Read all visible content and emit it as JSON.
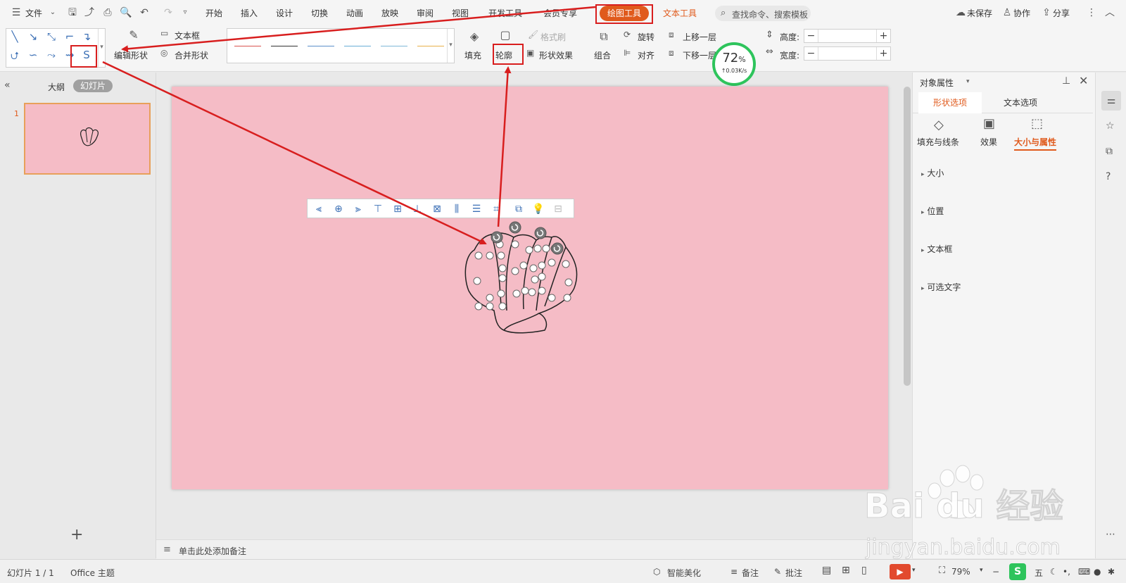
{
  "menubar": {
    "file": "文件",
    "tabs": [
      "开始",
      "插入",
      "设计",
      "切换",
      "动画",
      "放映",
      "审阅",
      "视图",
      "开发工具",
      "会员专享"
    ],
    "active_tab": "绘图工具",
    "text_tools_tab": "文本工具",
    "search_placeholder": "查找命令、搜索模板",
    "unsaved": "未保存",
    "collab": "协作",
    "share": "分享"
  },
  "ribbon": {
    "edit_shape": "编辑形状",
    "text_box": "文本框",
    "merge_shape": "合并形状",
    "fill": "填充",
    "outline": "轮廓",
    "format_painter": "格式刷",
    "shape_effect": "形状效果",
    "group": "组合",
    "rotate": "旋转",
    "align": "对齐",
    "bring_forward": "上移一层",
    "send_backward": "下移一层",
    "height_label": "高度:",
    "width_label": "宽度:",
    "line_colors": [
      "#d9534f",
      "#333333",
      "#5b8fc9",
      "#6aaed6",
      "#7fb8d8",
      "#e8b04a"
    ]
  },
  "speed_meter": {
    "percent": "72",
    "percent_sign": "%",
    "rate": "↑0.03K/s"
  },
  "left_panel": {
    "outline_tab": "大纲",
    "slides_tab": "幻灯片",
    "slide_number": "1",
    "add_button": "+"
  },
  "notes": {
    "placeholder": "单击此处添加备注"
  },
  "right_panel": {
    "title": "对象属性",
    "tab_shape": "形状选项",
    "tab_text": "文本选项",
    "sub_fill_line": "填充与线条",
    "sub_effect": "效果",
    "sub_size_prop": "大小与属性",
    "sections": [
      "大小",
      "位置",
      "文本框",
      "可选文字"
    ]
  },
  "status": {
    "slide_count": "幻灯片 1 / 1",
    "theme": "Office 主题",
    "beautify": "智能美化",
    "notes": "备注",
    "comments": "批注",
    "zoom": "79%"
  },
  "watermark": {
    "brand": "Bai du 经验",
    "url": "jingyan.baidu.com"
  },
  "colors": {
    "accent": "#e05a1c",
    "slide_bg": "#f5bcc6",
    "annotation_red": "#d81e1e",
    "speed_green": "#2ec45c"
  }
}
